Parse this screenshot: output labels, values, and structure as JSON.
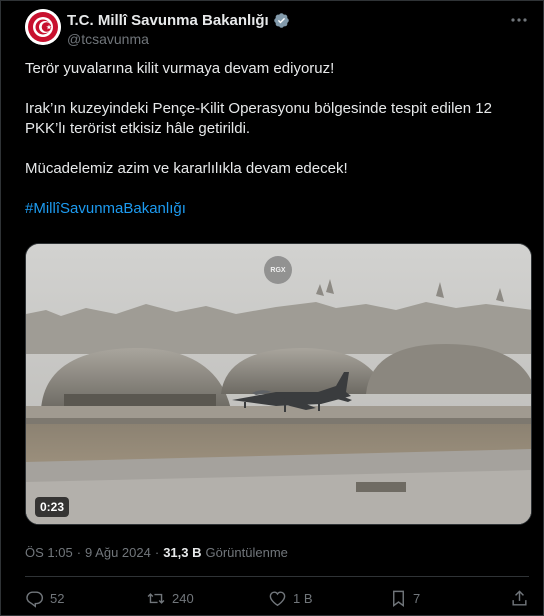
{
  "author": {
    "name": "T.C. Millî Savunma Bakanlığı",
    "handle": "@tcsavunma",
    "avatar_icon": "ministry-emblem-icon",
    "verified_icon": "verified-badge-icon"
  },
  "tweet": {
    "line1": "Terör yuvalarına kilit vurmaya devam ediyoruz!",
    "line2": "Irak’ın kuzeyindeki Pençe-Kilit Operasyonu bölgesinde tespit edilen 12 PKK’lı terörist etkisiz hâle getirildi.",
    "line3": "Mücadelemiz azim ve kararlılıkla devam edecek!",
    "hashtag": "#MillîSavunmaBakanlığı"
  },
  "media": {
    "duration": "0:23",
    "watermark": "RGX"
  },
  "meta": {
    "time": "ÖS 1:05",
    "separator": "·",
    "date": "9 Ağu 2024",
    "views_count": "31,3 B",
    "views_label": "Görüntülenme"
  },
  "actions": {
    "replies": "52",
    "reposts": "240",
    "likes": "1 B",
    "bookmarks": "7"
  },
  "colors": {
    "background": "#000000",
    "text": "#e7e9ea",
    "secondary": "#71767b",
    "link": "#1d9bf0",
    "border": "#2f3336"
  }
}
